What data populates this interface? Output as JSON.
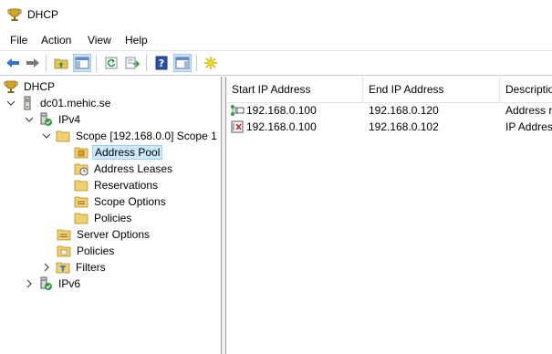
{
  "window": {
    "title": "DHCP"
  },
  "menu": [
    "File",
    "Action",
    "View",
    "Help"
  ],
  "toolbar": {
    "buttons": [
      {
        "icon": "back-arrow-icon"
      },
      {
        "icon": "forward-arrow-icon"
      },
      {
        "icon": "up-folder-icon"
      },
      {
        "icon": "show-hide-console-tree-icon"
      },
      {
        "icon": "refresh-icon"
      },
      {
        "icon": "export-list-icon"
      },
      {
        "icon": "help-icon"
      },
      {
        "icon": "show-hide-action-pane-icon"
      },
      {
        "icon": "new-star-icon"
      }
    ]
  },
  "tree": {
    "root": "DHCP",
    "server": "dc01.mehic.se",
    "ipv4": "IPv4",
    "scope": "Scope [192.168.0.0] Scope 1",
    "address_pool": "Address Pool",
    "address_leases": "Address Leases",
    "reservations": "Reservations",
    "scope_options": "Scope Options",
    "scope_policies": "Policies",
    "server_options": "Server Options",
    "policies": "Policies",
    "filters": "Filters",
    "ipv6": "IPv6"
  },
  "list": {
    "columns": [
      "Start IP Address",
      "End IP Address",
      "Descriptio"
    ],
    "rows": [
      {
        "start": "192.168.0.100",
        "end": "192.168.0.120",
        "description": "Address ra",
        "icon": "address-range-icon"
      },
      {
        "start": "192.168.0.100",
        "end": "192.168.0.102",
        "description": "IP Addres",
        "icon": "exclusion-range-icon"
      }
    ]
  }
}
